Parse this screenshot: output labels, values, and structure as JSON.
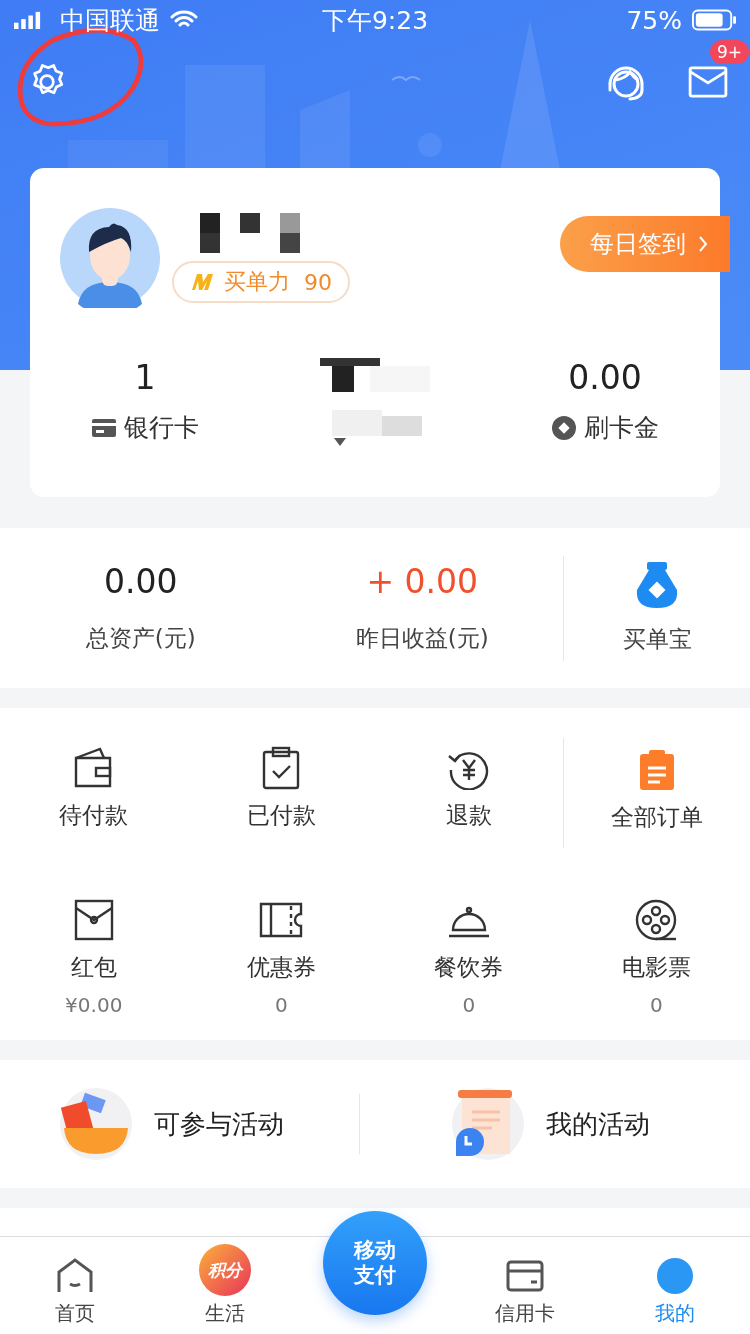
{
  "status_bar": {
    "carrier": "中国联通",
    "time": "下午9:23",
    "battery": "75%"
  },
  "header": {
    "message_badge": "9+"
  },
  "profile": {
    "power_label": "买单力",
    "power_value": "90",
    "checkin": "每日签到",
    "stats": [
      {
        "value": "1",
        "label": "银行卡"
      },
      {
        "value": "0.00",
        "label": "刷卡金"
      }
    ]
  },
  "assets": {
    "items": [
      {
        "value": "0.00",
        "label": "总资产(元)"
      },
      {
        "value": "+ 0.00",
        "label": "昨日收益(元)"
      }
    ],
    "side": {
      "label": "买单宝"
    }
  },
  "orders": [
    {
      "label": "待付款"
    },
    {
      "label": "已付款"
    },
    {
      "label": "退款"
    },
    {
      "label": "全部订单"
    }
  ],
  "wallet": [
    {
      "label": "红包",
      "value": "¥0.00"
    },
    {
      "label": "优惠券",
      "value": "0"
    },
    {
      "label": "餐饮券",
      "value": "0"
    },
    {
      "label": "电影票",
      "value": "0"
    }
  ],
  "activities": [
    {
      "label": "可参与活动"
    },
    {
      "label": "我的活动"
    }
  ],
  "tabs": [
    {
      "label": "首页",
      "selected": false
    },
    {
      "label": "生活",
      "badge": "积分",
      "selected": false
    },
    {
      "label": "移动支付",
      "selected": false
    },
    {
      "label": "信用卡",
      "selected": false
    },
    {
      "label": "我的",
      "selected": true
    }
  ]
}
